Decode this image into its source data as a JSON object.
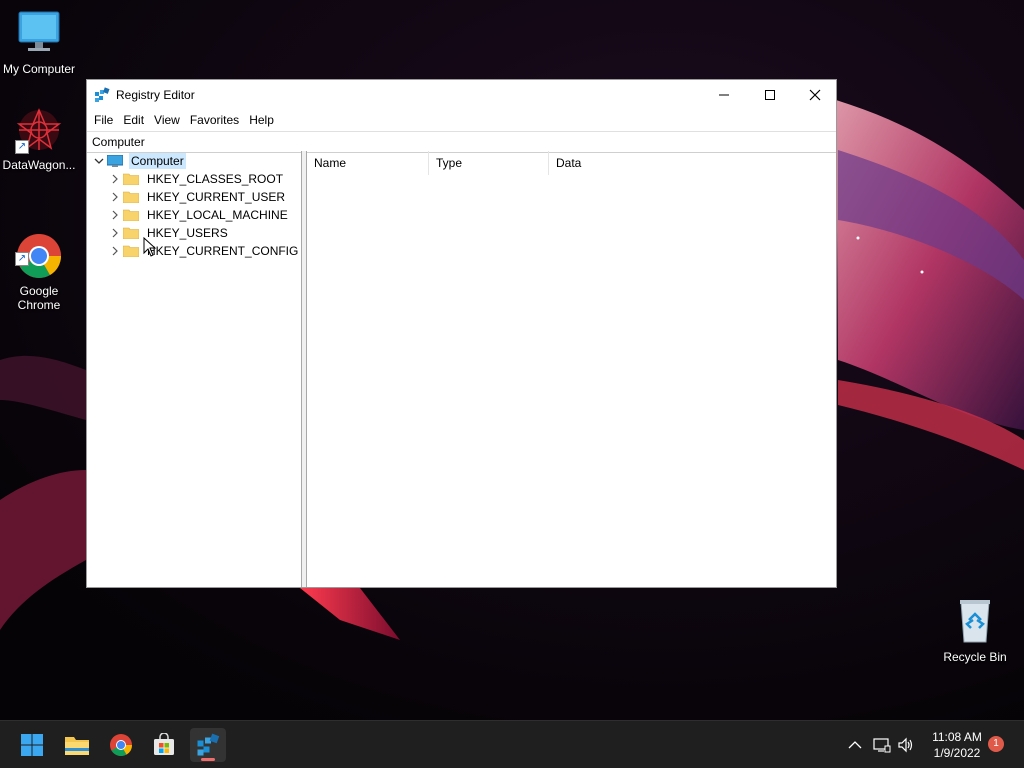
{
  "desktop": {
    "icons": [
      {
        "label": "My Computer",
        "icon": "monitor-icon"
      },
      {
        "label": "DataWagon...",
        "icon": "datawagon-app-icon"
      },
      {
        "label": "Google\nChrome",
        "icon": "chrome-icon"
      },
      {
        "label": "Recycle Bin",
        "icon": "recycle-bin-icon"
      }
    ]
  },
  "window": {
    "title": "Registry Editor",
    "menu": [
      "File",
      "Edit",
      "View",
      "Favorites",
      "Help"
    ],
    "address": "Computer",
    "tree": {
      "root": "Computer",
      "children": [
        "HKEY_CLASSES_ROOT",
        "HKEY_CURRENT_USER",
        "HKEY_LOCAL_MACHINE",
        "HKEY_USERS",
        "HKEY_CURRENT_CONFIG"
      ]
    },
    "columns": [
      "Name",
      "Type",
      "Data"
    ]
  },
  "taskbar": {
    "pinned": [
      "start-icon",
      "file-explorer-icon",
      "chrome-icon",
      "store-icon",
      "registry-editor-icon"
    ],
    "active": "registry-editor-icon",
    "clock": {
      "time": "11:08 AM",
      "date": "1/9/2022"
    },
    "notification_count": "1"
  },
  "colors": {
    "selection": "#cce8ff",
    "taskbar": "#1f1f1f",
    "active_indicator": "#f06d6d"
  }
}
